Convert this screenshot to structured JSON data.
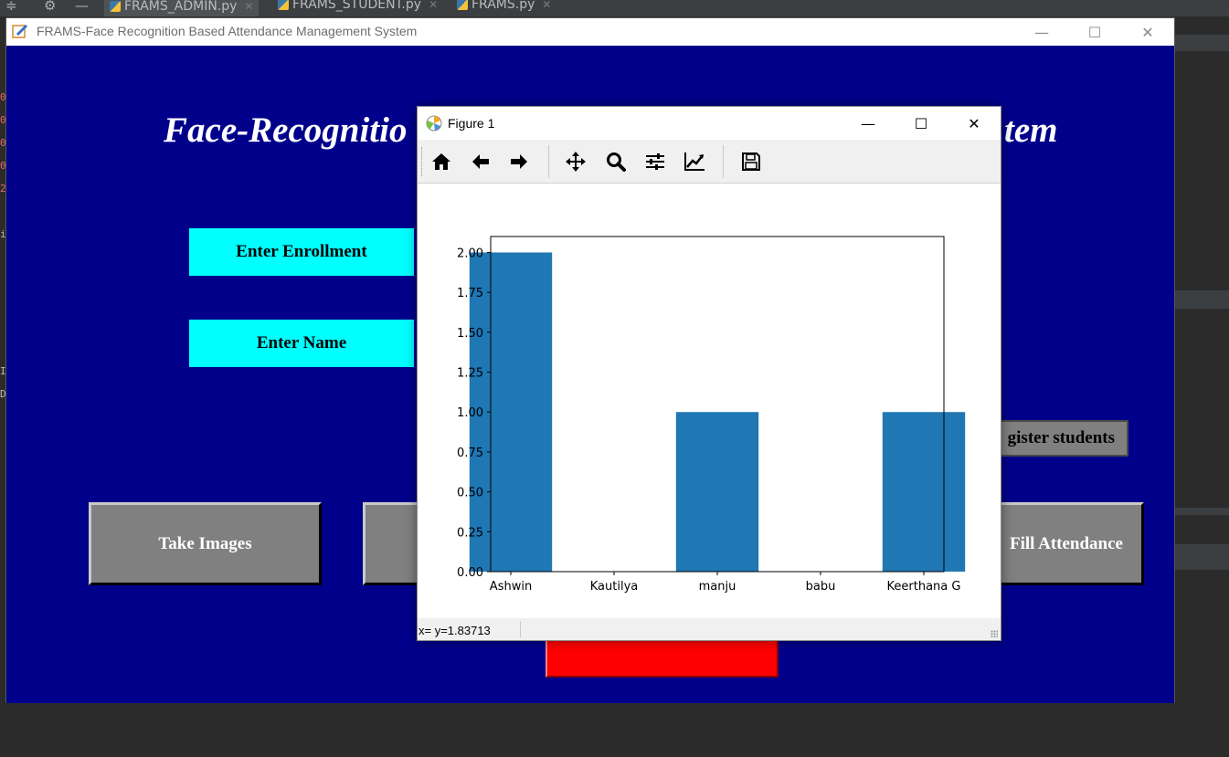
{
  "ide": {
    "tabs": [
      {
        "label": "FRAMS_ADMIN.py",
        "active": true
      },
      {
        "label": "FRAMS_STUDENT.py",
        "active": false
      },
      {
        "label": "FRAMS.py",
        "active": false
      }
    ]
  },
  "app": {
    "title": "FRAMS-Face Recognition Based Attendance Management System",
    "heading_left": "Face-Recognitio",
    "heading_right": "tem",
    "enroll_label": "Enter Enrollment",
    "name_label": "Enter Name",
    "register_button": "gister students",
    "take_images_button": "Take Images",
    "fill_attendance_button": "Fill Attendance",
    "colors": {
      "background": "#00008b",
      "label": "#00ffff",
      "button": "#808080",
      "danger": "#ff0000"
    }
  },
  "figure": {
    "title": "Figure 1",
    "toolbar": [
      "home-icon",
      "back-icon",
      "forward-icon",
      "pan-icon",
      "zoom-icon",
      "configure-subplots-icon",
      "edit-axis-icon",
      "save-icon"
    ],
    "status": "x= y=1.83713"
  },
  "chart_data": {
    "type": "bar",
    "categories": [
      "Ashwin",
      "Kautilya",
      "manju",
      "babu",
      "Keerthana G"
    ],
    "values": [
      2,
      0,
      1,
      0,
      1
    ],
    "ylim": [
      0,
      2.1
    ],
    "yticks": [
      "0.00",
      "0.25",
      "0.50",
      "0.75",
      "1.00",
      "1.25",
      "1.50",
      "1.75",
      "2.00"
    ],
    "bar_color": "#1f77b4",
    "grid": false,
    "title": "",
    "xlabel": "",
    "ylabel": ""
  }
}
